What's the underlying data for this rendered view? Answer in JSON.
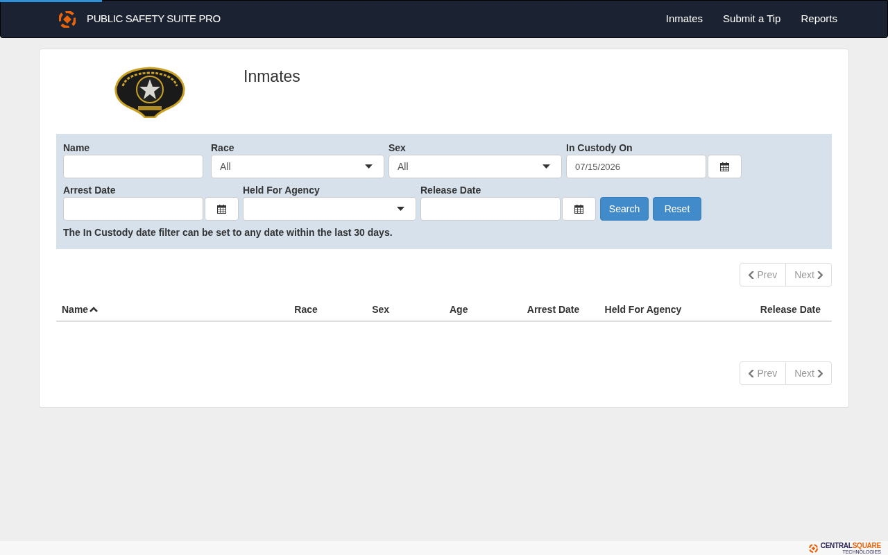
{
  "navbar": {
    "brand": "PUBLIC SAFETY SUITE PRO",
    "links": [
      {
        "label": "Inmates"
      },
      {
        "label": "Submit a Tip"
      },
      {
        "label": "Reports"
      }
    ],
    "loading_bar": {
      "level": 0.115
    }
  },
  "page": {
    "title": "Inmates"
  },
  "filters": {
    "row_1": [
      {
        "kind": "text",
        "label": "Name"
      },
      {
        "kind": "select",
        "label": "Race",
        "value": "All"
      },
      {
        "kind": "select",
        "label": "Sex",
        "value": "All"
      },
      {
        "kind": "date",
        "label": "In Custody On",
        "value": "07/15/2026"
      }
    ],
    "row_2": [
      {
        "kind": "date",
        "label": "Arrest Date"
      },
      {
        "kind": "select",
        "label": "Held For Agency"
      },
      {
        "kind": "date",
        "label": "Release Date"
      }
    ],
    "buttons": [
      {
        "label": "Search"
      },
      {
        "label": "Reset"
      }
    ],
    "note": "The In Custody date filter can be set to any date within the last 30 days."
  },
  "pager_top": [
    {
      "label": "Prev",
      "kind": "prev",
      "disabled": true
    },
    {
      "label": "Next",
      "kind": "next",
      "disabled": true
    }
  ],
  "table": {
    "columns": [
      {
        "label": "Name",
        "sorted": true
      },
      {
        "label": "Race",
        "sorted": false
      },
      {
        "label": "Sex",
        "sorted": false
      },
      {
        "label": "Age",
        "sorted": false
      },
      {
        "label": "Arrest Date",
        "sorted": false
      },
      {
        "label": "Held For Agency",
        "sorted": false
      },
      {
        "label": "Release Date",
        "sorted": false
      }
    ]
  },
  "pager_bottom": [
    {
      "label": "Prev",
      "kind": "prev",
      "disabled": true
    },
    {
      "label": "Next",
      "kind": "next",
      "disabled": true
    }
  ],
  "footer": {
    "logo_part_1": "CENTRAL",
    "logo_part_2": "SQUARE",
    "logo_tagline": "TECHNOLOGIES"
  }
}
